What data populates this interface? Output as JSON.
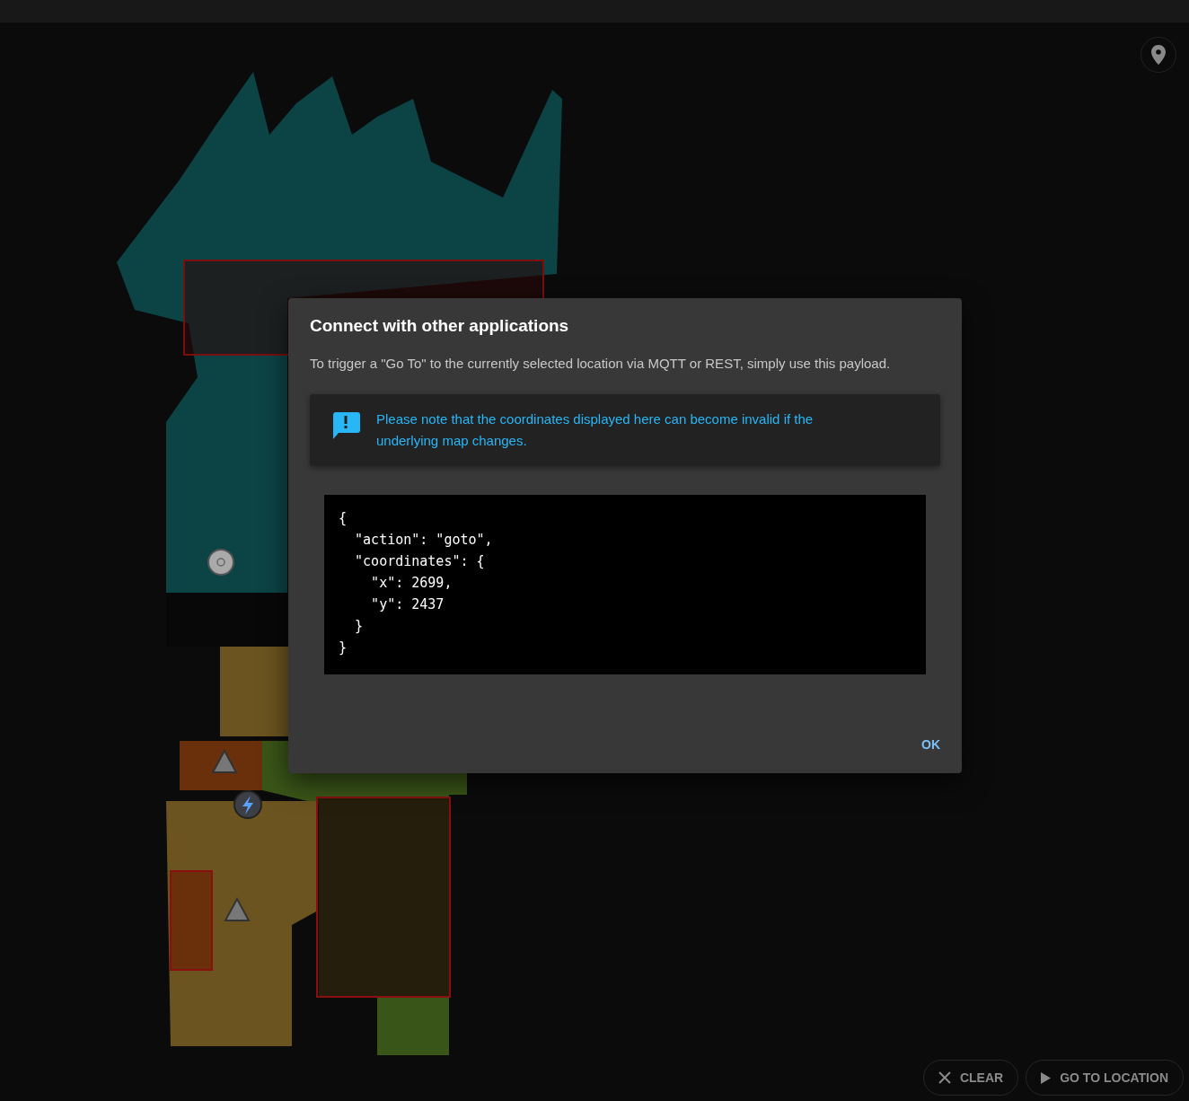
{
  "dialog": {
    "title": "Connect with other applications",
    "description": "To trigger a \"Go To\" to the currently selected location via MQTT or REST, simply use this payload.",
    "notice": "Please note that the coordinates displayed here can become invalid if the underlying map changes.",
    "payload": "{\n  \"action\": \"goto\",\n  \"coordinates\": {\n    \"x\": 2699,\n    \"y\": 2437\n  }\n}",
    "ok_button": "OK"
  },
  "actions": [
    {
      "kind": "clear",
      "label": "CLEAR"
    },
    {
      "kind": "goto",
      "label": "GO TO LOCATION"
    }
  ]
}
